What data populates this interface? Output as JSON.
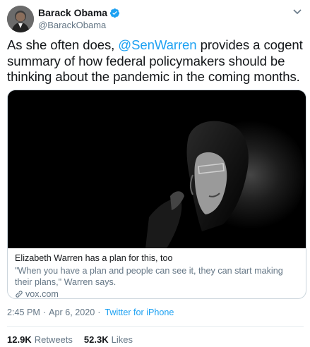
{
  "author": {
    "display_name": "Barack Obama",
    "handle": "@BarackObama",
    "verified": true
  },
  "tweet": {
    "text_before": "As she often does, ",
    "mention": "@SenWarren",
    "text_after": " provides a cogent summary of how federal policymakers should be thinking about the pandemic in the coming months."
  },
  "card": {
    "title": "Elizabeth Warren has a plan for this, too",
    "description": "\"When you have a plan and people can see it, they can start making their plans,\" Warren says.",
    "domain": "vox.com"
  },
  "meta": {
    "time": "2:45 PM",
    "separator": "·",
    "date": "Apr 6, 2020",
    "source": "Twitter for iPhone"
  },
  "stats": {
    "retweets_count": "12.9K",
    "retweets_label": "Retweets",
    "likes_count": "52.3K",
    "likes_label": "Likes"
  },
  "colors": {
    "link": "#1da1f2",
    "secondary_text": "#657786",
    "primary_text": "#14171a",
    "border": "#ccd6dd"
  }
}
